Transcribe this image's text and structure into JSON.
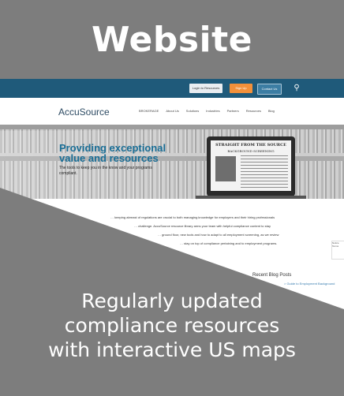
{
  "title": "Website",
  "caption": [
    "Regularly updated",
    "compliance resources",
    "with interactive US maps"
  ],
  "colors": {
    "band": "#7d7d7d",
    "utility_bar": "#1f5a7a",
    "accent": "#f3903a",
    "hero_text": "#1a6e96"
  },
  "site": {
    "utility": {
      "login": "Login to Resources",
      "register": "Sign Up",
      "other": "Contact Us",
      "search_icon": "search-icon"
    },
    "logo": "AccuSource",
    "nav": [
      "BROKERAGE",
      "About Us",
      "Solutions",
      "Industries",
      "Partners",
      "Resources",
      "Blog"
    ],
    "hero": {
      "headline1": "Providing exceptional",
      "headline2": "value and resources",
      "sub": "The tools to keep you in the know and your programs compliant.",
      "screen_title": "STRAIGHT FROM THE SOURCE",
      "screen_sub": "BACKGROUND SCREENING"
    },
    "body_lines": [
      "… keeping abreast of regulations are crucial to both managing knowledge for employers and their hiring professionals",
      "… challenge. AccuSource resource library arms your team with helpful compliance content to stay",
      "… ground floor, new tools and how to adapt to all employment screening, as we review",
      "… stay on top of compliance pertaining and to employment programs."
    ],
    "blog_heading": "Recent Blog Posts",
    "blog_link": "> Guide to Employment Background",
    "notice": "Notice Terms"
  }
}
